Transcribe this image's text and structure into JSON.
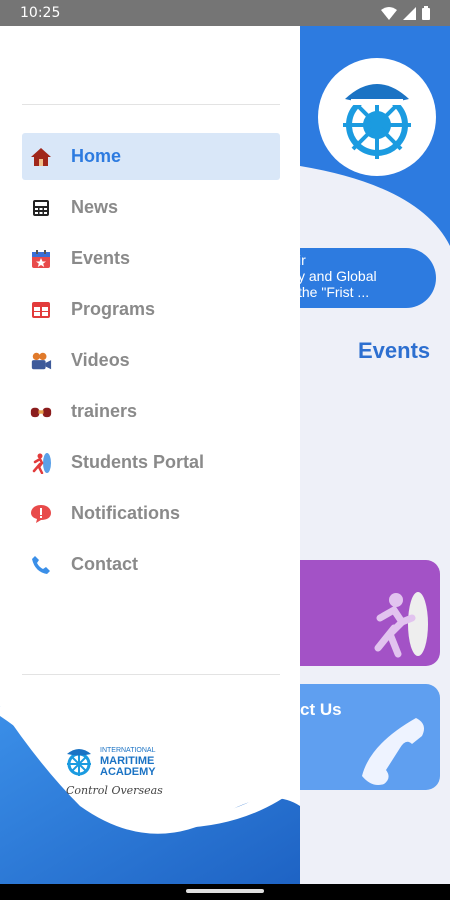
{
  "status_bar": {
    "time": "10:25"
  },
  "background_screen": {
    "news_lines": [
      "ir",
      "y and Global",
      "the \"Frist ..."
    ],
    "section_title": "Events",
    "contact_card_label": "ct Us"
  },
  "drawer": {
    "menu": [
      {
        "label": "Home",
        "icon": "home-icon",
        "active": true
      },
      {
        "label": "News",
        "icon": "news-icon",
        "active": false
      },
      {
        "label": "Events",
        "icon": "calendar-icon",
        "active": false
      },
      {
        "label": "Programs",
        "icon": "programs-icon",
        "active": false
      },
      {
        "label": "Videos",
        "icon": "video-camera-icon",
        "active": false
      },
      {
        "label": "trainers",
        "icon": "trainers-icon",
        "active": false
      },
      {
        "label": "Students Portal",
        "icon": "student-portal-icon",
        "active": false
      },
      {
        "label": "Notifications",
        "icon": "notification-icon",
        "active": false
      },
      {
        "label": "Contact",
        "icon": "phone-icon",
        "active": false
      }
    ],
    "footer_logo": {
      "line1": "INTERNATIONAL",
      "line2": "MARITIME",
      "line3": "ACADEMY",
      "signature": "Control Overseas"
    }
  },
  "colors": {
    "accent": "#2d7be0",
    "active_bg": "#d9e7f8",
    "purple_card": "#a352c6",
    "blue_card": "#5f9ff0"
  }
}
